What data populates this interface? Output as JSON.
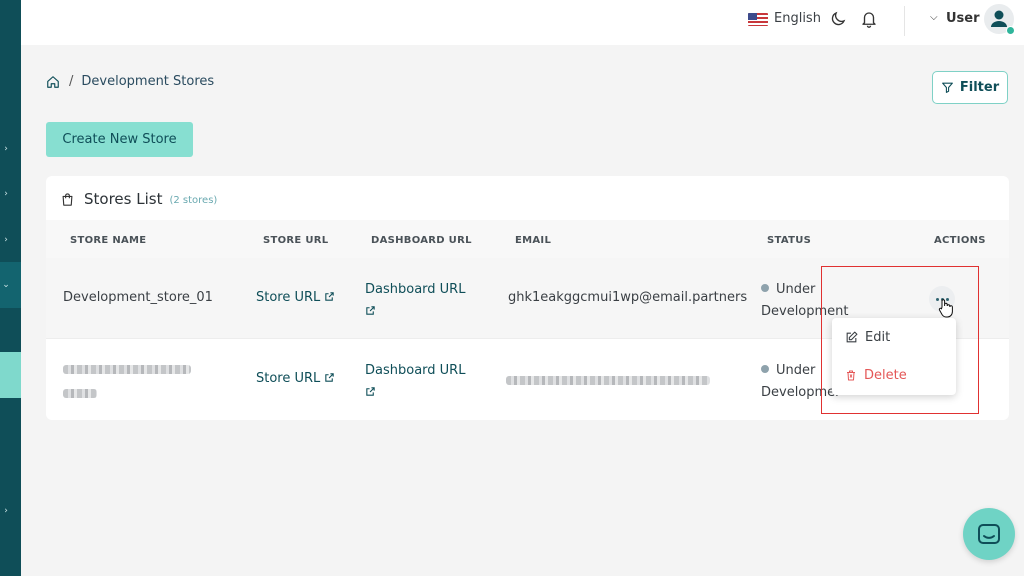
{
  "topbar": {
    "language": "English",
    "user_label": "User"
  },
  "breadcrumb": {
    "separator": "/",
    "current": "Development Stores"
  },
  "toolbar": {
    "filter_label": "Filter",
    "create_label": "Create New Store"
  },
  "stores_list": {
    "title": "Stores List",
    "count": "(2 stores)",
    "columns": [
      "STORE NAME",
      "STORE URL",
      "DASHBOARD URL",
      "EMAIL",
      "STATUS",
      "ACTIONS"
    ],
    "rows": [
      {
        "store_name": "Development_store_01",
        "store_url": "Store URL",
        "dashboard_url": "Dashboard URL",
        "email": "ghk1eakggcmui1wp@email.partners",
        "status_line1": "Under",
        "status_line2": "Development"
      },
      {
        "store_name": "",
        "store_url": "Store URL",
        "dashboard_url": "Dashboard URL",
        "email": "",
        "status_line1": "Under",
        "status_line2": "Developmer"
      }
    ]
  },
  "actions_menu": {
    "edit_label": "Edit",
    "delete_label": "Delete"
  },
  "colors": {
    "sidebar": "#0f4e58",
    "accent": "#87dfd1",
    "delete": "#e45757",
    "highlight": "#e03131"
  }
}
